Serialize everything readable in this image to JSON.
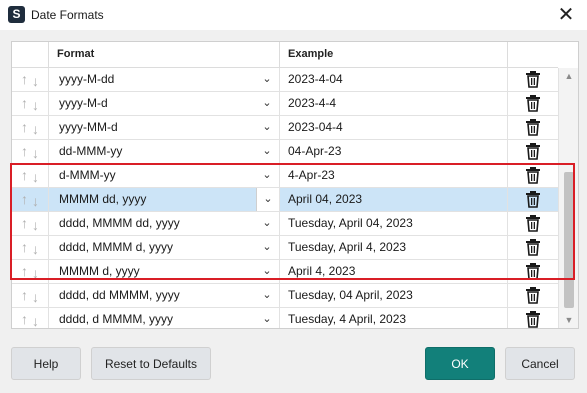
{
  "window": {
    "title": "Date Formats",
    "app_icon_letter": "S"
  },
  "table": {
    "headers": {
      "move": "",
      "format": "Format",
      "example": "Example",
      "delete": ""
    },
    "rows": [
      {
        "format": "yyyy-M-dd",
        "example": "2023-4-04",
        "selected": false
      },
      {
        "format": "yyyy-M-d",
        "example": "2023-4-4",
        "selected": false
      },
      {
        "format": "yyyy-MM-d",
        "example": "2023-04-4",
        "selected": false
      },
      {
        "format": "dd-MMM-yy",
        "example": "04-Apr-23",
        "selected": false
      },
      {
        "format": "d-MMM-yy",
        "example": "4-Apr-23",
        "selected": false
      },
      {
        "format": "MMMM dd, yyyy",
        "example": "April 04, 2023",
        "selected": true
      },
      {
        "format": "dddd, MMMM dd, yyyy",
        "example": "Tuesday, April 04, 2023",
        "selected": false
      },
      {
        "format": "dddd, MMMM d, yyyy",
        "example": "Tuesday, April 4, 2023",
        "selected": false
      },
      {
        "format": "MMMM d, yyyy",
        "example": "April 4, 2023",
        "selected": false
      },
      {
        "format": "dddd, dd MMMM, yyyy",
        "example": "Tuesday, 04 April, 2023",
        "selected": false
      },
      {
        "format": "dddd, d MMMM, yyyy",
        "example": "Tuesday, 4 April, 2023",
        "selected": false
      }
    ]
  },
  "icons": {
    "move_up": "arrow-up-icon",
    "move_down": "arrow-down-icon",
    "dropdown": "chevron-down-icon",
    "delete": "trash-icon",
    "close": "close-icon"
  },
  "buttons": {
    "help": "Help",
    "reset": "Reset to Defaults",
    "ok": "OK",
    "cancel": "Cancel"
  },
  "colors": {
    "accent": "#12807a",
    "selection": "#cce4f7",
    "highlight_border": "#d91e26"
  }
}
